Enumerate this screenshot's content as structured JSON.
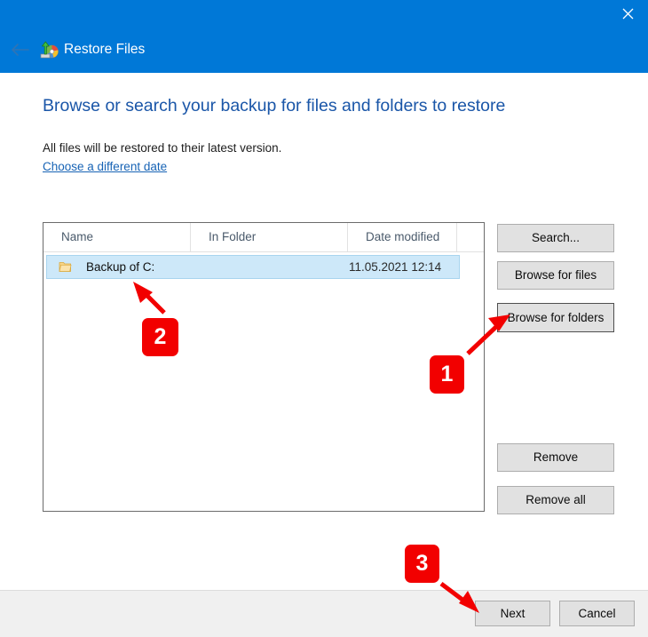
{
  "window": {
    "title": "Restore Files",
    "app_icon": "restore-files-icon",
    "back_icon": "back-arrow-icon",
    "close_icon": "close-icon",
    "accent_color": "#0078d7"
  },
  "content": {
    "heading": "Browse or search your backup for files and folders to restore",
    "subtext": "All files will be restored to their latest version.",
    "link_label": "Choose a different date",
    "link_color": "#1763b5",
    "heading_color": "#1a56a8"
  },
  "list": {
    "columns": [
      "Name",
      "In Folder",
      "Date modified"
    ],
    "rows": [
      {
        "icon": "folder-icon",
        "name": "Backup of C:",
        "in_folder": "",
        "date_modified": "11.05.2021 12:14",
        "selected": true
      }
    ],
    "selection_color": "#cde8f9"
  },
  "side_buttons": [
    {
      "label": "Search...",
      "name": "search-button",
      "focused": false
    },
    {
      "label": "Browse for files",
      "name": "browse-for-files-button",
      "focused": false
    },
    {
      "label": "Browse for folders",
      "name": "browse-for-folders-button",
      "focused": true
    },
    {
      "label": "Remove",
      "name": "remove-button",
      "focused": false
    },
    {
      "label": "Remove all",
      "name": "remove-all-button",
      "focused": false
    }
  ],
  "footer": {
    "next_label": "Next",
    "cancel_label": "Cancel"
  },
  "annotations": {
    "color": "#f20000",
    "markers": [
      {
        "label": "1",
        "points_to": "browse-for-folders-button"
      },
      {
        "label": "2",
        "points_to": "table-row-backup-of-c"
      },
      {
        "label": "3",
        "points_to": "next-button"
      }
    ]
  }
}
